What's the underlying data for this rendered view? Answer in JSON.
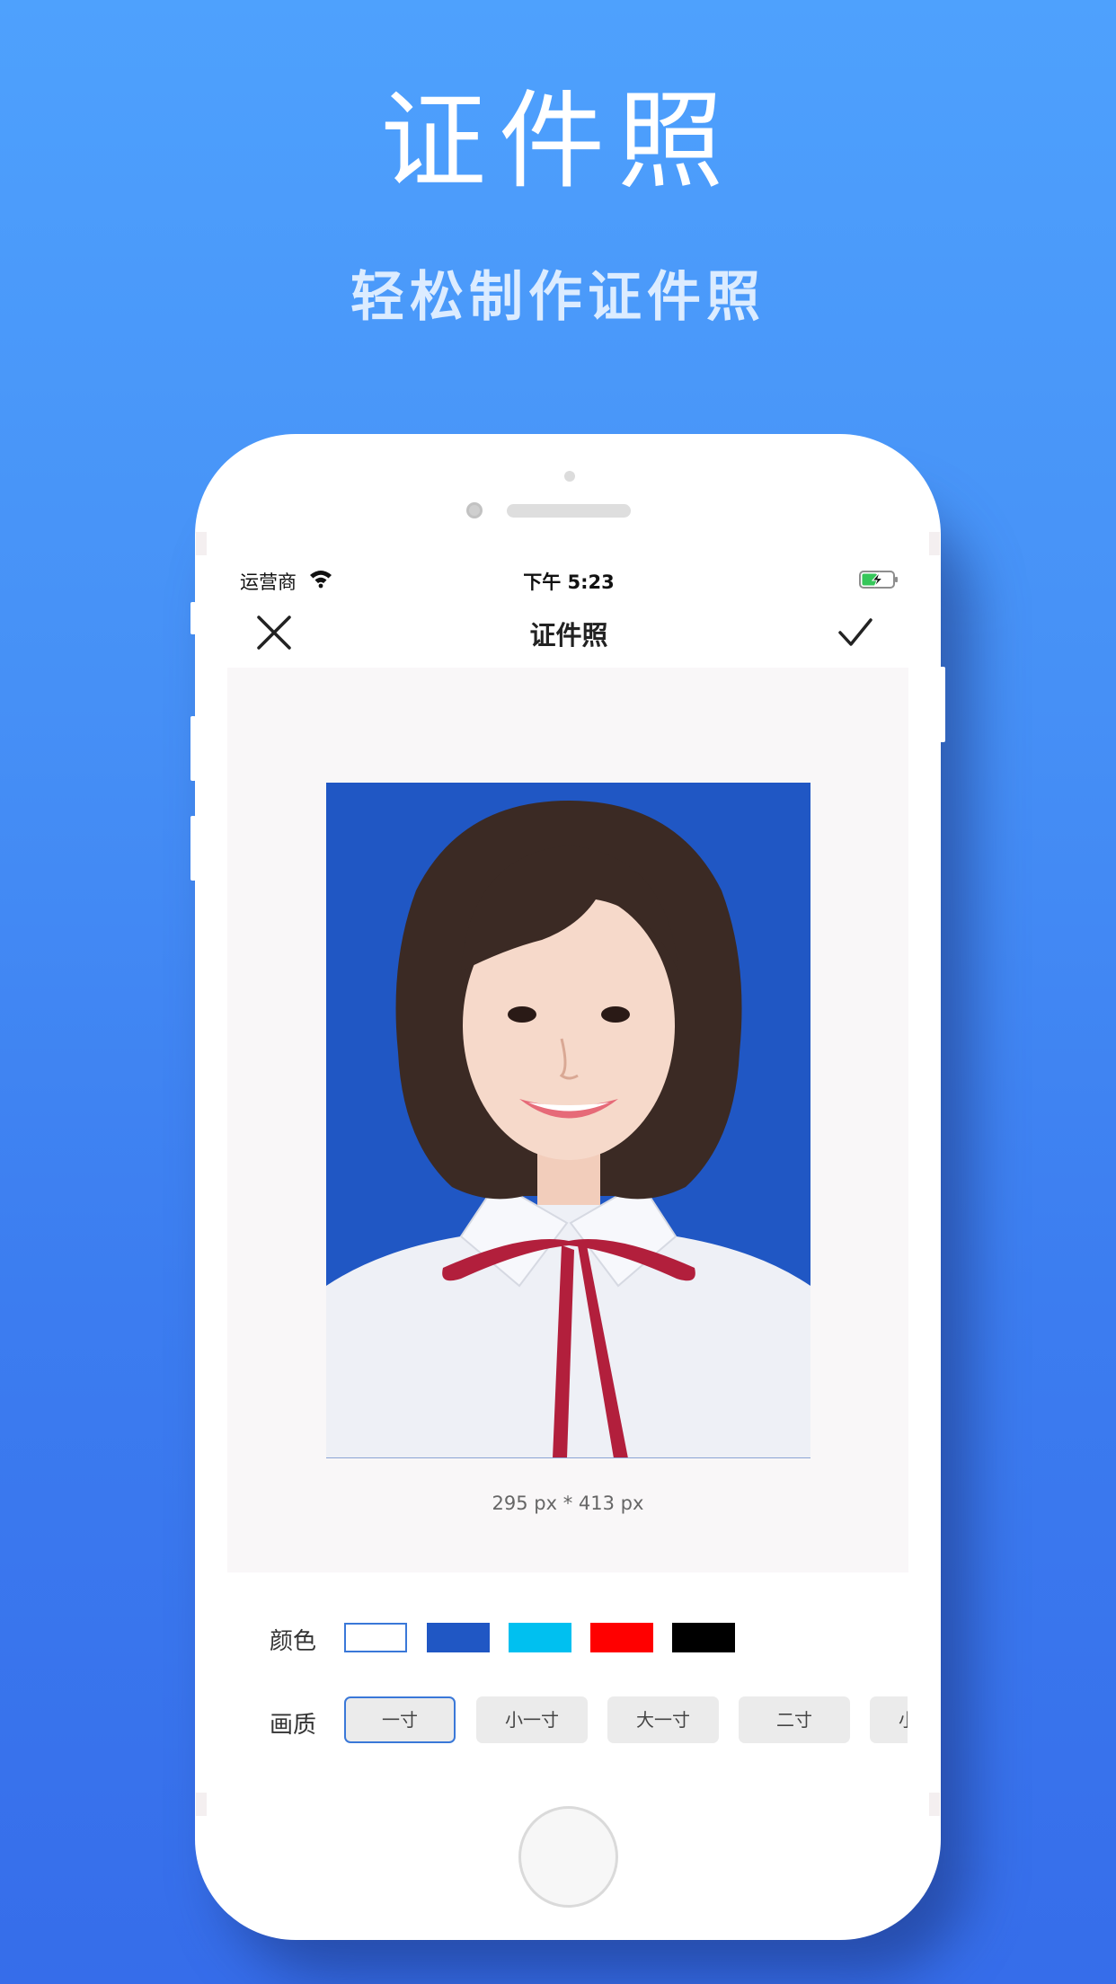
{
  "promo": {
    "title": "证件照",
    "subtitle": "轻松制作证件照"
  },
  "status_bar": {
    "carrier": "运营商",
    "time": "下午 5:23",
    "battery_level": 0.5,
    "battery_charging": true,
    "icons": [
      "wifi-icon",
      "battery-charging-icon"
    ]
  },
  "nav": {
    "title": "证件照",
    "close_icon": "close-icon",
    "confirm_icon": "checkmark-icon"
  },
  "preview": {
    "background_color": "#2057c4",
    "size_text": "295 px * 413 px"
  },
  "controls": {
    "color_label": "颜色",
    "colors": [
      {
        "name": "white",
        "hex": "#ffffff",
        "selected": true
      },
      {
        "name": "blue",
        "hex": "#2057c4",
        "selected": false
      },
      {
        "name": "cyan",
        "hex": "#00c0f0",
        "selected": false
      },
      {
        "name": "red",
        "hex": "#ff0000",
        "selected": false
      },
      {
        "name": "black",
        "hex": "#000000",
        "selected": false
      }
    ],
    "quality_label": "画质",
    "sizes": [
      {
        "label": "一寸",
        "selected": true
      },
      {
        "label": "小一寸",
        "selected": false
      },
      {
        "label": "大一寸",
        "selected": false
      },
      {
        "label": "二寸",
        "selected": false
      },
      {
        "label": "小二寸",
        "selected": false
      }
    ]
  },
  "theme": {
    "accent": "#3a78d8",
    "chip_bg": "#ebebeb",
    "preview_bg": "#f9f7f8"
  }
}
